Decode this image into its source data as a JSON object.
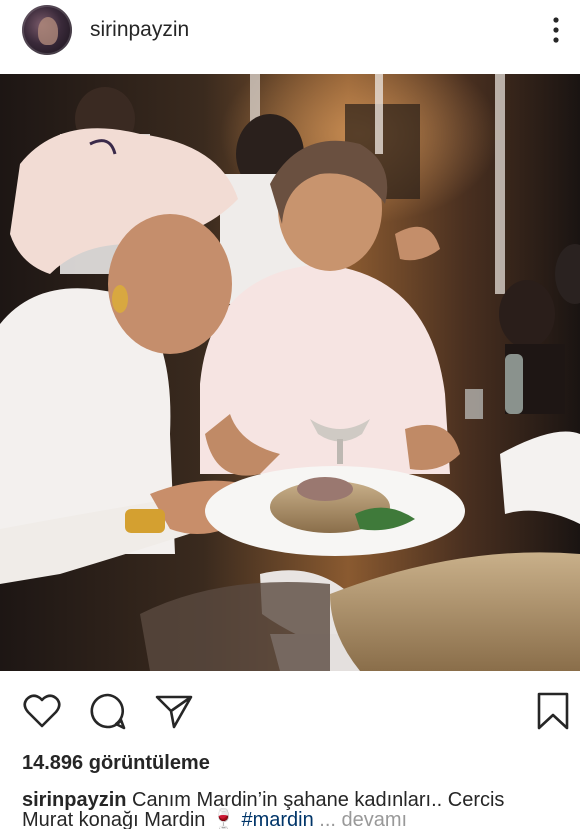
{
  "header": {
    "username": "sirinpayzin"
  },
  "icons": {
    "avatar": "profile-avatar",
    "more": "more-vertical-icon",
    "like": "heart-icon",
    "comment": "comment-icon",
    "share": "share-icon",
    "save": "bookmark-icon"
  },
  "post": {
    "views": "14.896 görüntüleme",
    "caption_user": "sirinpayzin",
    "caption_line1": "Canım Mardin’in şahane kadınları.. Cercis",
    "caption_line2_start": "Murat konağı Mardin",
    "caption_hashtag": "#mardin",
    "caption_more": "... devamı"
  },
  "colors": {
    "text": "#262626",
    "hashtag": "#003569",
    "muted": "#999999"
  }
}
